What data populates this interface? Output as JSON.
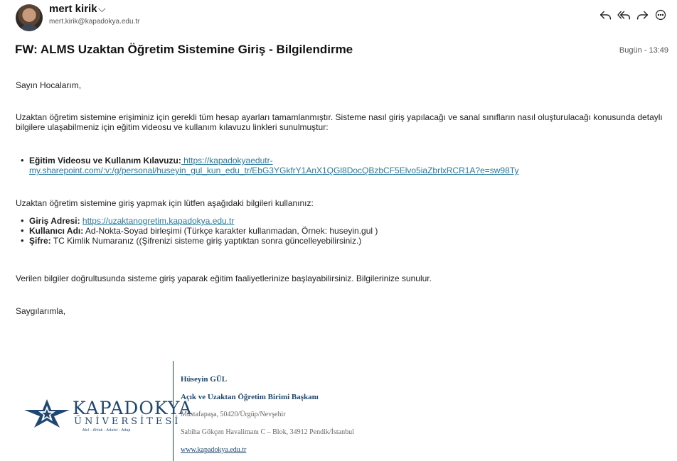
{
  "sender": {
    "name": "mert kirik",
    "email": "mert.kirik@kapadokya.edu.tr",
    "avatar_icon": "user-avatar"
  },
  "actions": [
    {
      "name": "reply-button",
      "icon": "reply-icon"
    },
    {
      "name": "reply-all-button",
      "icon": "reply-all-icon"
    },
    {
      "name": "forward-button",
      "icon": "forward-icon"
    },
    {
      "name": "more-button",
      "icon": "more-icon"
    }
  ],
  "subject": "FW: ALMS Uzaktan Öğretim Sistemine Giriş - Bilgilendirme",
  "date": "Bugün - 13:49",
  "body": {
    "greeting": "Sayın Hocalarım,",
    "intro": "Uzaktan öğretim sistemine erişiminiz için gerekli tüm hesap ayarları tamamlanmıştır. Sisteme nasıl giriş yapılacağı ve sanal sınıfların nasıl oluşturulacağı konusunda detaylı bilgilere ulaşabilmeniz için eğitim videosu ve kullanım kılavuzu linkleri sunulmuştur:",
    "video_label": "Eğitim Videosu ve Kullanım Kılavuzu:",
    "video_link": " https://kapadokyaedutr-my.sharepoint.com/:v:/g/personal/huseyin_gul_kun_edu_tr/EbG3YGkfrY1AnX1QGl8DocQBzbCF5Elvo5iaZbrlxRCR1A?e=sw98Ty",
    "login_intro": "Uzaktan öğretim sistemine giriş yapmak için lütfen aşağıdaki bilgileri kullanınız:",
    "items": [
      {
        "label": "Giriş Adresi:",
        "text": "",
        "link": "https://uzaktanogretim.kapadokya.edu.tr"
      },
      {
        "label": "Kullanıcı Adı:",
        "text": "Ad-Nokta-Soyad birleşimi (Türkçe karakter kullanmadan, Örnek: huseyin.gul )",
        "link": ""
      },
      {
        "label": "Şifre:",
        "text": "TC Kimlik Numaranız ((Şifrenizi sisteme giriş yaptıktan sonra güncelleyebilirsiniz.)",
        "link": ""
      }
    ],
    "closing": "Verilen bilgiler doğrultusunda sisteme giriş yaparak eğitim faaliyetlerinize başlayabilirsiniz. Bilgilerinize sunulur.",
    "signoff": "Saygılarımla,"
  },
  "signature": {
    "logo_name": "KAPADOKYA",
    "logo_sub": "ÜNİVERSİTESİ",
    "logo_motto": "Akıl - Ahlak - Adalet - Adap",
    "name": "Hüseyin GÜL",
    "title": "Açık ve Uzaktan Öğretim Birimi Başkanı",
    "address1": "Mustafapaşa, 50420/Ürgüp/Nevşehir",
    "address2": "Sabiha Gökçen Havalimanı C – Blok, 34912 Pendik/İstanbul",
    "website": "www.kapadokya.edu.tr"
  },
  "colors": {
    "link": "#2a7aa0",
    "brand": "#1f4770"
  }
}
